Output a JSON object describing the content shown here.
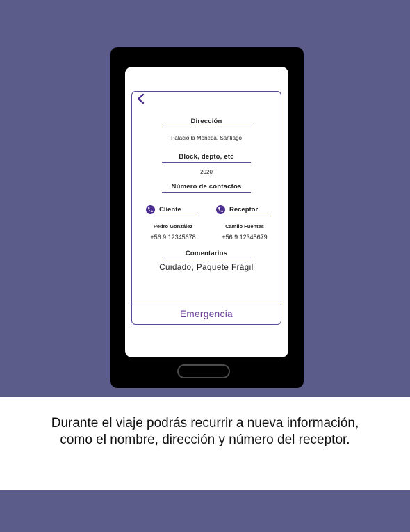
{
  "form": {
    "address_label": "Dirección",
    "address_value": "Palacio la Moneda, Santiago",
    "block_label": "Block, depto, etc",
    "block_value": "2020",
    "contacts_label": "Número de contactos",
    "client_label": "Cliente",
    "receiver_label": "Receptor",
    "client_name": "Pedro González",
    "client_phone": "+56 9 12345678",
    "receiver_name": "Camilo Fuentes",
    "receiver_phone": "+56 9 12345679",
    "comments_label": "Comentarios",
    "comments_value": "Cuidado, Paquete Frágil",
    "emergency_label": "Emergencia"
  },
  "caption": {
    "text": "Durante el viaje podrás recurrir a nueva información, como el nombre, dirección y número del receptor."
  },
  "colors": {
    "background": "#5b5c8a",
    "accent": "#4b2d8f",
    "emergency_text": "#6a3d9a"
  },
  "icons": {
    "back": "chevron-left-icon",
    "phone": "phone-icon"
  }
}
